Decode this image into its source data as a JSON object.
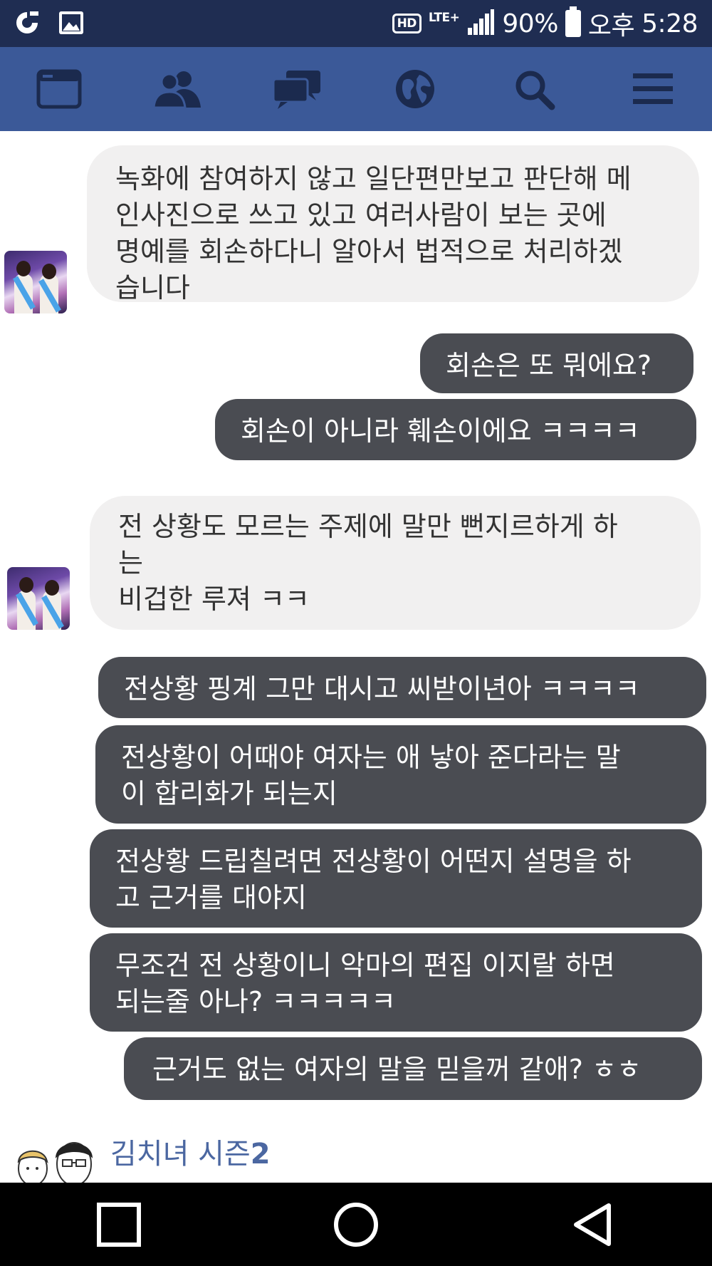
{
  "status_bar": {
    "hd": "HD",
    "network": "LTE+",
    "battery": "90%",
    "ampm": "오후",
    "time": "5:28"
  },
  "nav": {
    "icons": [
      "news-feed-icon",
      "friends-icon",
      "messages-icon",
      "notifications-globe-icon",
      "search-icon",
      "menu-icon"
    ]
  },
  "messages": [
    {
      "side": "in",
      "text": "녹화에 참여하지 않고 일단편만보고 판단해 메\n인사진으로 쓰고 있고 여러사람이 보는 곳에\n명예를 회손하다니 알아서 법적으로 처리하겠\n습니다"
    },
    {
      "side": "out",
      "text": "회손은 또 뭐에요?"
    },
    {
      "side": "out",
      "text": "회손이 아니라 훼손이에요 ㅋㅋㅋㅋ"
    },
    {
      "side": "in",
      "text": "전 상황도 모르는 주제에 말만 뻔지르하게 하\n는\n비겁한 루져 ㅋㅋ"
    },
    {
      "side": "out",
      "text": "전상황 핑계 그만 대시고 씨받이년아 ㅋㅋㅋㅋ"
    },
    {
      "side": "out",
      "text": "전상황이 어때야 여자는 애 낳아 준다라는 말\n이 합리화가 되는지"
    },
    {
      "side": "out",
      "text": "전상황 드립칠려면 전상황이 어떤지 설명을 하\n고 근거를 대야지"
    },
    {
      "side": "out",
      "text": "무조건 전 상황이니 악마의 편집 이지랄 하면\n되는줄 아나? ㅋㅋㅋㅋㅋ"
    },
    {
      "side": "out",
      "text": "근거도 없는 여자의 말을 믿을꺼 같애? ㅎㅎ"
    }
  ],
  "page_name": {
    "text": "김치녀 시즌",
    "number": "2"
  },
  "colors": {
    "status_bar": "#1f2d52",
    "facebook_blue": "#3b5998",
    "incoming_bubble": "#f1f0f0",
    "outgoing_bubble": "#4a4c52",
    "page_name": "#4b67a1"
  }
}
